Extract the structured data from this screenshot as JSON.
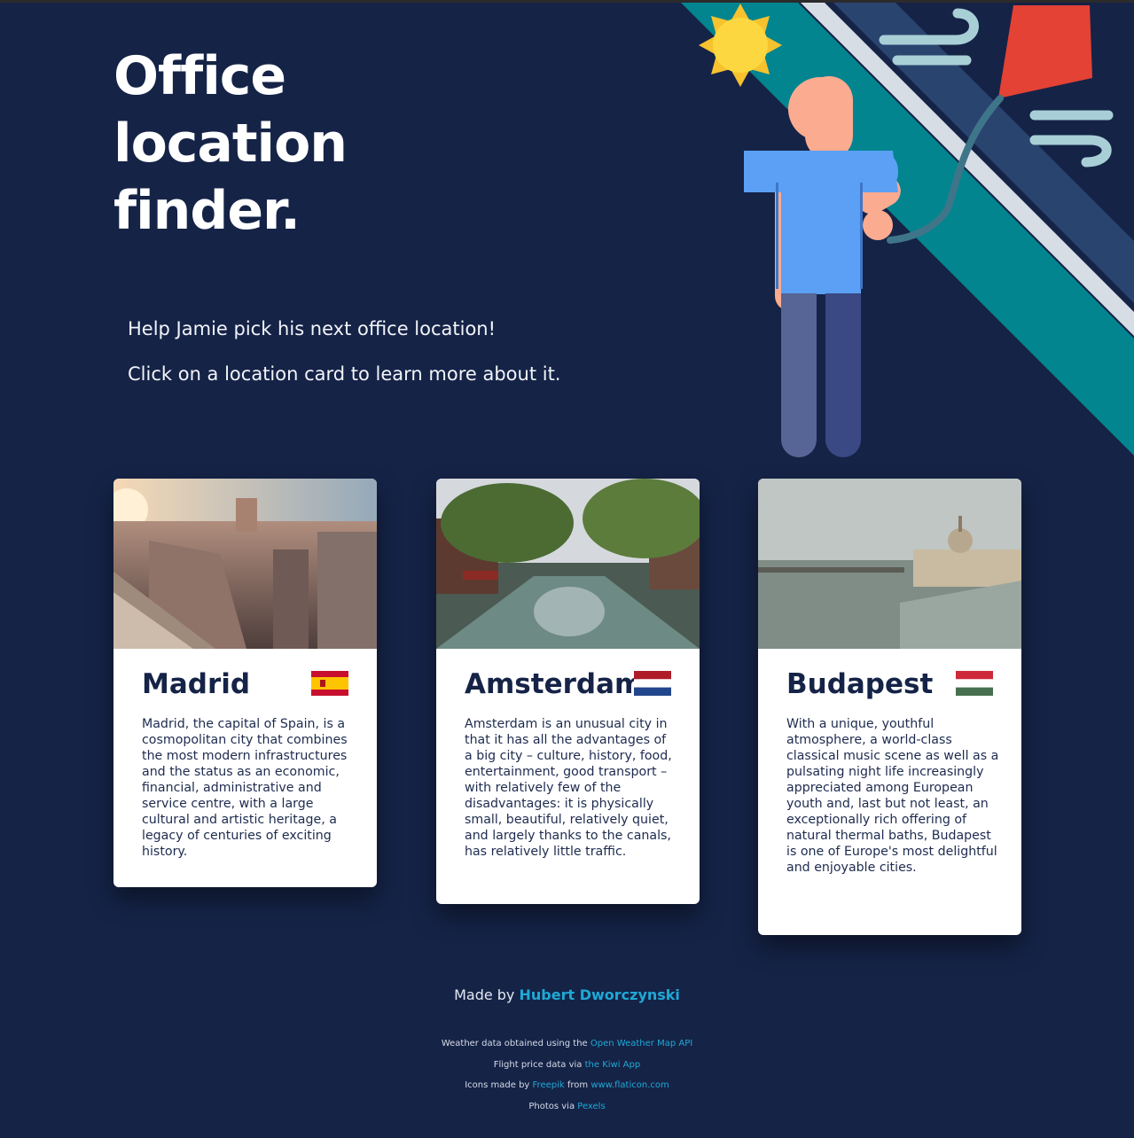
{
  "hero": {
    "title_lines": [
      "Office",
      "location",
      "finder."
    ]
  },
  "intro": {
    "line1": "Help Jamie pick his next office location!",
    "line2": "Click on a location card to learn more about it."
  },
  "cards": [
    {
      "title": "Madrid",
      "flag": "spain-flag",
      "description": "Madrid, the capital of Spain, is a cosmopolitan city that combines the most modern infrastructures and the status as an economic, financial, administrative and service centre, with a large cultural and artistic heritage, a legacy of centuries of exciting history."
    },
    {
      "title": "Amsterdam",
      "flag": "netherlands-flag",
      "description": "Amsterdam is an unusual city in that it has all the advantages of a big city – culture, history, food, entertainment, good transport – with relatively few of the disadvantages: it is physically small, beautiful, relatively quiet, and largely thanks to the canals, has relatively little traffic."
    },
    {
      "title": "Budapest",
      "flag": "hungary-flag",
      "description": "With a unique, youthful atmosphere, a world-class classical music scene as well as a pulsating night life increasingly appreciated among European youth and, last but not least, an exceptionally rich offering of natural thermal baths, Budapest is one of Europe's most delightful and enjoyable cities."
    }
  ],
  "footer": {
    "made_by_prefix": "Made by",
    "author": "Hubert Dworczynski",
    "weather_prefix": "Weather data obtained using the",
    "weather_link": "Open Weather Map API",
    "flight_prefix": "Flight price data via",
    "flight_link": "the Kiwi App",
    "icons_prefix": "Icons made by",
    "icons_author": "Freepik",
    "icons_from": "from",
    "icons_site": "www.flaticon.com",
    "photos_prefix": "Photos via",
    "photos_link": "Pexels"
  },
  "colors": {
    "background": "#152347",
    "card": "#ffffff",
    "heading": "#152347",
    "link": "#1fa9d6",
    "kite": "#e34234",
    "shirt": "#5ba0f4",
    "stripe_teal": "#02858f"
  },
  "icons": [
    "sun-icon",
    "wind-icon",
    "kite-icon",
    "person-illustration"
  ]
}
